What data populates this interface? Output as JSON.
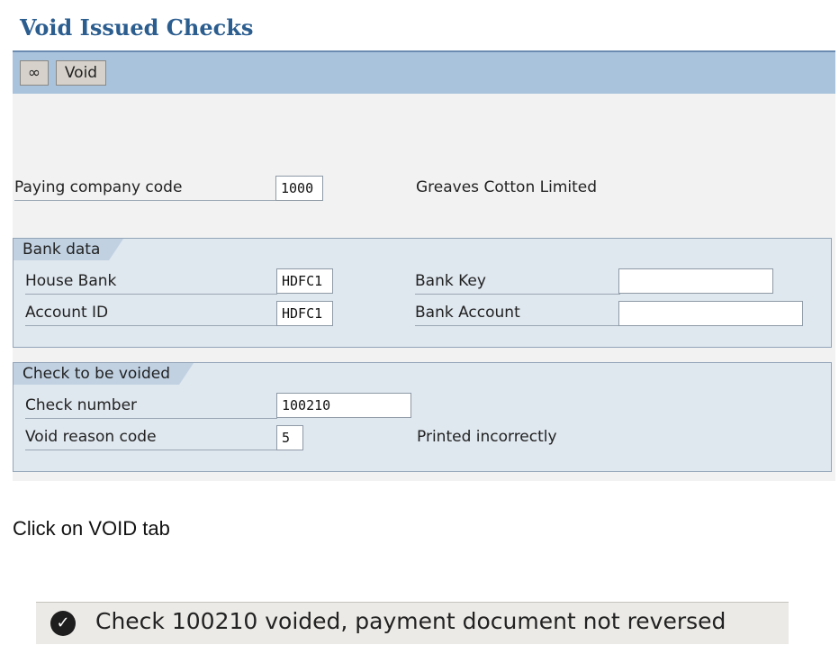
{
  "page": {
    "title": "Void Issued Checks"
  },
  "toolbar": {
    "icon_glyph": "∞",
    "void_label": "Void"
  },
  "paying_company": {
    "label": "Paying company code",
    "value": "1000",
    "name": "Greaves Cotton Limited"
  },
  "bank_data": {
    "title": "Bank data",
    "house_bank_label": "House Bank",
    "house_bank_value": "HDFC1",
    "account_id_label": "Account ID",
    "account_id_value": "HDFC1",
    "bank_key_label": "Bank Key",
    "bank_key_value": "",
    "bank_account_label": "Bank Account",
    "bank_account_value": ""
  },
  "check_section": {
    "title": "Check to be voided",
    "check_number_label": "Check number",
    "check_number_value": "100210",
    "void_reason_label": "Void reason code",
    "void_reason_value": "5",
    "void_reason_text": "Printed incorrectly"
  },
  "instruction": "Click on VOID  tab",
  "status": {
    "icon": "✓",
    "message": "Check 100210 voided, payment document not reversed"
  },
  "colors": {
    "title": "#2b5d8f",
    "toolbar": "#a9c3dd",
    "group_bg": "#dfe7ef"
  }
}
